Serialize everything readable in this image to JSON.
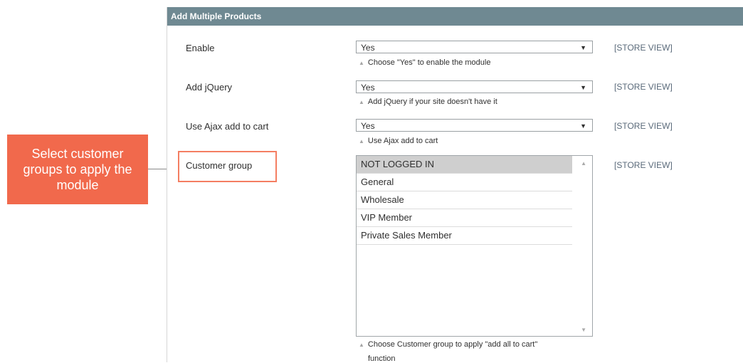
{
  "panel": {
    "title": "Add Multiple Products"
  },
  "fields": {
    "enable": {
      "label": "Enable",
      "value": "Yes",
      "note": "Choose \"Yes\" to enable the module",
      "scope": "[STORE VIEW]"
    },
    "jquery": {
      "label": "Add jQuery",
      "value": "Yes",
      "note": "Add jQuery if your site doesn't have it",
      "scope": "[STORE VIEW]"
    },
    "ajax": {
      "label": "Use Ajax add to cart",
      "value": "Yes",
      "note": "Use Ajax add to cart",
      "scope": "[STORE VIEW]"
    },
    "customer_group": {
      "label": "Customer group",
      "options": [
        "NOT LOGGED IN",
        "General",
        "Wholesale",
        "VIP Member",
        "Private Sales Member"
      ],
      "selected": "NOT LOGGED IN",
      "note_line1": "Choose Customer group to apply \"add all to cart\"",
      "note_line2": "function",
      "scope": "[STORE VIEW]"
    }
  },
  "callout": {
    "text": "Select customer groups to apply the module"
  },
  "glyphs": {
    "dropdown_arrow": "▼",
    "note_triangle": "▲",
    "scroll_up": "▲",
    "scroll_down": "▼"
  },
  "colors": {
    "header_bg": "#6f8992",
    "callout_bg": "#f1694c",
    "highlight_border": "#f47e62",
    "selected_option_bg": "#cfcfcf"
  }
}
